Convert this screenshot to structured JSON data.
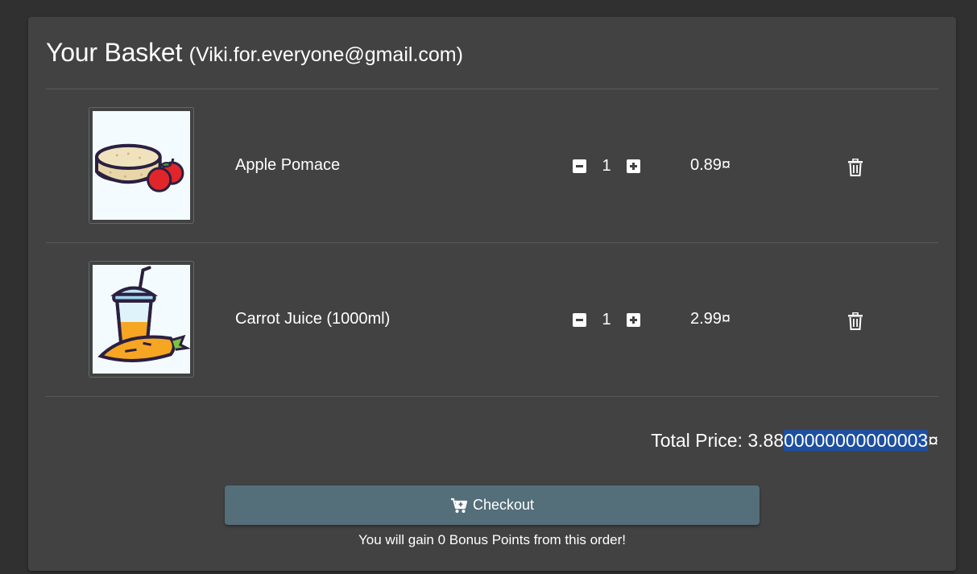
{
  "basket": {
    "title": "Your Basket",
    "email": "(Viki.for.everyone@gmail.com)"
  },
  "items": [
    {
      "name": "Apple Pomace",
      "quantity": "1",
      "price": "0.89¤",
      "image_icon": "apple-pomace-icon"
    },
    {
      "name": "Carrot Juice (1000ml)",
      "quantity": "1",
      "price": "2.99¤",
      "image_icon": "carrot-juice-icon"
    }
  ],
  "total": {
    "label": "Total Price:",
    "value_plain": "3.88",
    "value_selected": "00000000000003",
    "currency": "¤"
  },
  "checkout": {
    "label": "Checkout",
    "bonus_text": "You will gain 0 Bonus Points from this order!"
  },
  "colors": {
    "page_bg": "#303030",
    "card_bg": "#424242",
    "checkout_bg": "#546e7a",
    "selection": "#1d4fa0"
  }
}
